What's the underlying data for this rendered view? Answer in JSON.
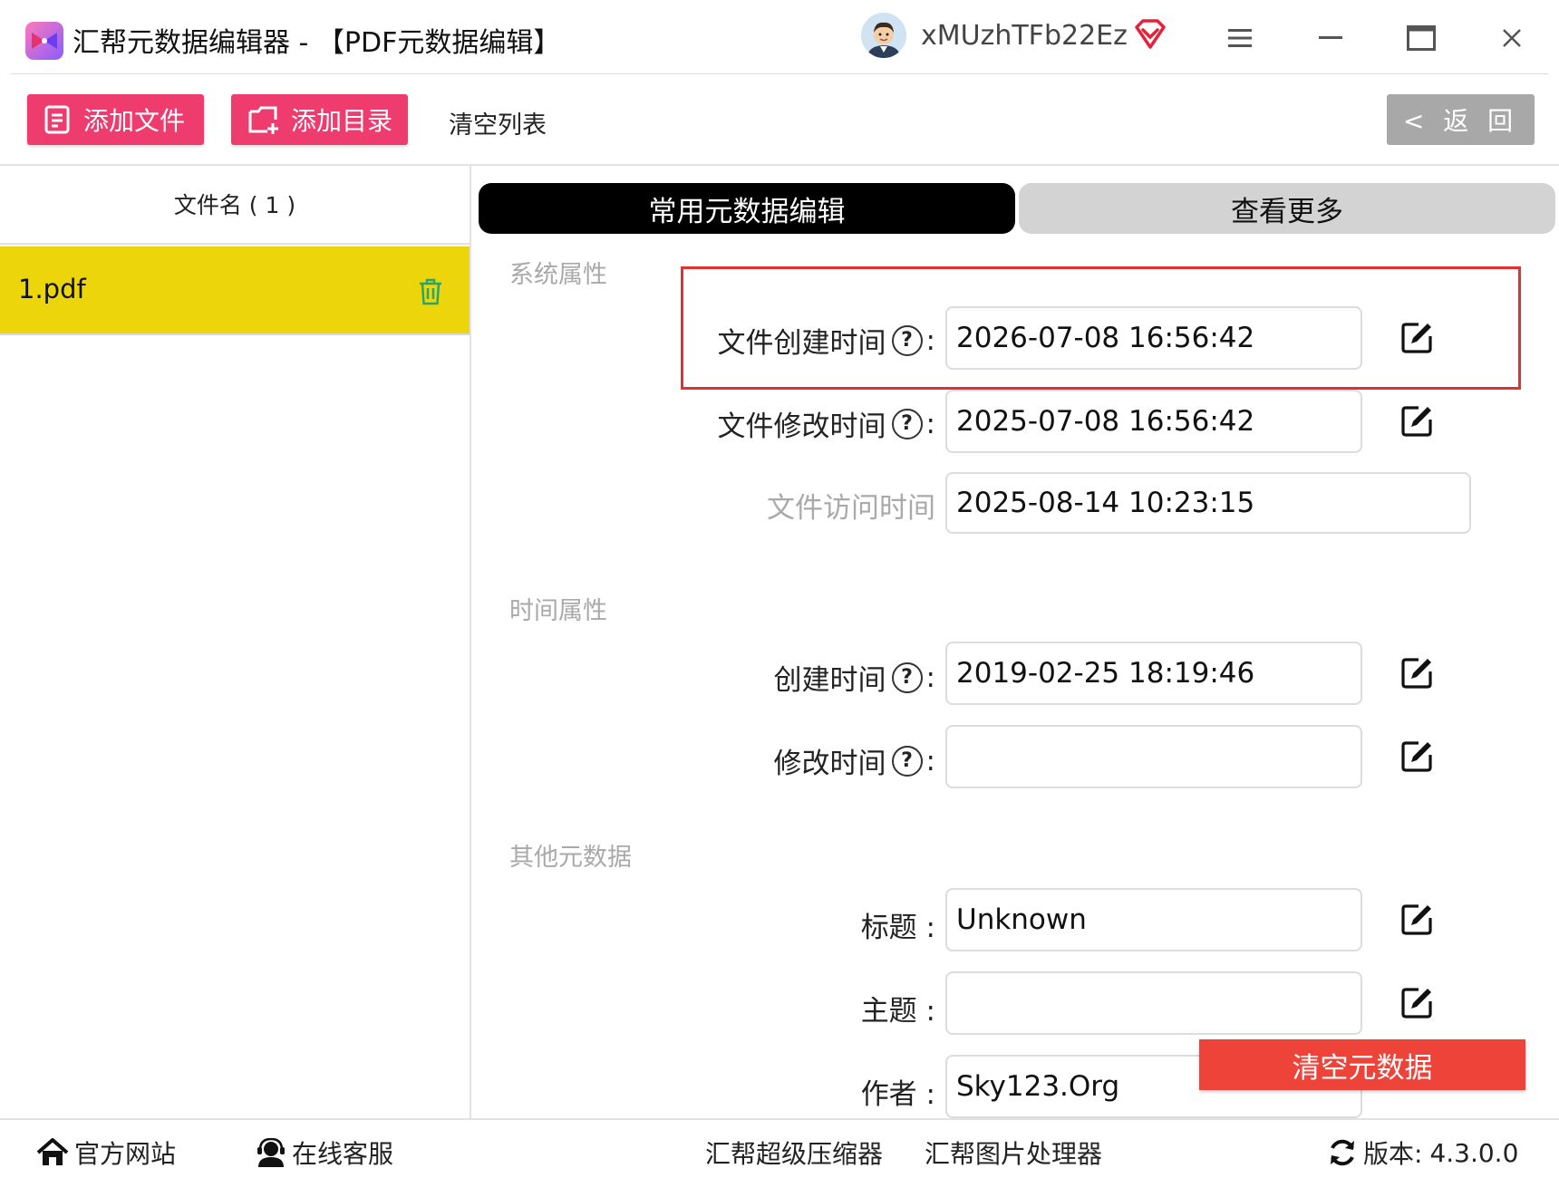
{
  "window": {
    "title": "汇帮元数据编辑器 - 【PDF元数据编辑】",
    "username": "xMUzhTFb22Ez"
  },
  "toolbar": {
    "add_file": "添加文件",
    "add_folder": "添加目录",
    "clear_list": "清空列表",
    "back": "< 返 回"
  },
  "file_list": {
    "header": "文件名 ( 1 )",
    "items": [
      {
        "name": "1.pdf"
      }
    ]
  },
  "tabs": [
    {
      "label": "常用元数据编辑",
      "active": true
    },
    {
      "label": "查看更多",
      "active": false
    }
  ],
  "sections": {
    "system": {
      "label": "系统属性",
      "file_created": {
        "label": "文件创建时间",
        "value": "2026-07-08 16:56:42"
      },
      "file_modified": {
        "label": "文件修改时间",
        "value": "2025-07-08 16:56:42"
      },
      "file_accessed": {
        "label": "文件访问时间",
        "value": "2025-08-14 10:23:15"
      }
    },
    "time": {
      "label": "时间属性",
      "created": {
        "label": "创建时间",
        "value": "2019-02-25 18:19:46"
      },
      "modified": {
        "label": "修改时间",
        "value": ""
      }
    },
    "other": {
      "label": "其他元数据",
      "title": {
        "label": "标题 :",
        "value": "Unknown"
      },
      "subject": {
        "label": "主题 :",
        "value": ""
      },
      "author": {
        "label": "作者 :",
        "value": "Sky123.Org"
      }
    }
  },
  "clear_metadata": "清空元数据",
  "footer": {
    "website": "官方网站",
    "support": "在线客服",
    "compressor": "汇帮超级压缩器",
    "image_tool": "汇帮图片处理器",
    "version_label": "版本:",
    "version": "4.3.0.0"
  },
  "colors": {
    "accent_pink": "#ee3c6e",
    "selected_row": "#ecd50b",
    "highlight_border": "#e53030",
    "clear_button": "#ee4338"
  }
}
